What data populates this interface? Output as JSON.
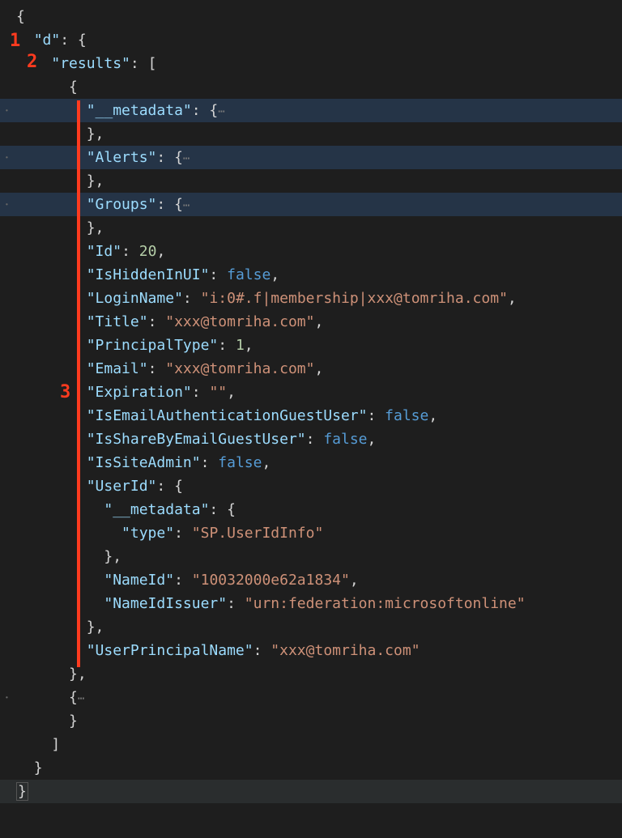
{
  "annotations": {
    "m1": "1",
    "m2": "2",
    "m3": "3"
  },
  "code": {
    "l0": "{",
    "l1_key": "\"d\"",
    "l1_after": ": {",
    "l2_key": "\"results\"",
    "l2_after": ": [",
    "l3": "{",
    "l4_key": "\"__metadata\"",
    "l4_after": ": {",
    "l4_ellipsis": "⋯",
    "l5": "},",
    "l6_key": "\"Alerts\"",
    "l6_after": ": {",
    "l6_ellipsis": "⋯",
    "l7": "},",
    "l8_key": "\"Groups\"",
    "l8_after": ": {",
    "l8_ellipsis": "⋯",
    "l9": "},",
    "l10_key": "\"Id\"",
    "l10_colon": ": ",
    "l10_val": "20",
    "l10_comma": ",",
    "l11_key": "\"IsHiddenInUI\"",
    "l11_colon": ": ",
    "l11_val": "false",
    "l11_comma": ",",
    "l12_key": "\"LoginName\"",
    "l12_colon": ": ",
    "l12_val": "\"i:0#.f|membership|xxx@tomriha.com\"",
    "l12_comma": ",",
    "l13_key": "\"Title\"",
    "l13_colon": ": ",
    "l13_val": "\"xxx@tomriha.com\"",
    "l13_comma": ",",
    "l14_key": "\"PrincipalType\"",
    "l14_colon": ": ",
    "l14_val": "1",
    "l14_comma": ",",
    "l15_key": "\"Email\"",
    "l15_colon": ": ",
    "l15_val": "\"xxx@tomriha.com\"",
    "l15_comma": ",",
    "l16_key": "\"Expiration\"",
    "l16_colon": ": ",
    "l16_val": "\"\"",
    "l16_comma": ",",
    "l17_key": "\"IsEmailAuthenticationGuestUser\"",
    "l17_colon": ": ",
    "l17_val": "false",
    "l17_comma": ",",
    "l18_key": "\"IsShareByEmailGuestUser\"",
    "l18_colon": ": ",
    "l18_val": "false",
    "l18_comma": ",",
    "l19_key": "\"IsSiteAdmin\"",
    "l19_colon": ": ",
    "l19_val": "false",
    "l19_comma": ",",
    "l20_key": "\"UserId\"",
    "l20_after": ": {",
    "l21_key": "\"__metadata\"",
    "l21_after": ": {",
    "l22_key": "\"type\"",
    "l22_colon": ": ",
    "l22_val": "\"SP.UserIdInfo\"",
    "l23": "},",
    "l24_key": "\"NameId\"",
    "l24_colon": ": ",
    "l24_val": "\"10032000e62a1834\"",
    "l24_comma": ",",
    "l25_key": "\"NameIdIssuer\"",
    "l25_colon": ": ",
    "l25_val": "\"urn:federation:microsoftonline\"",
    "l26": "},",
    "l27_key": "\"UserPrincipalName\"",
    "l27_colon": ": ",
    "l27_val": "\"xxx@tomriha.com\"",
    "l28": "},",
    "l29": "{",
    "l29_ellipsis": "⋯",
    "l30": "}",
    "l31": "]",
    "l32": "}",
    "l33": "}"
  },
  "indent": {
    "i0": "",
    "i1": "  ",
    "i2": "    ",
    "i3": "      ",
    "i4": "        ",
    "i5": "          ",
    "i6": "            "
  }
}
